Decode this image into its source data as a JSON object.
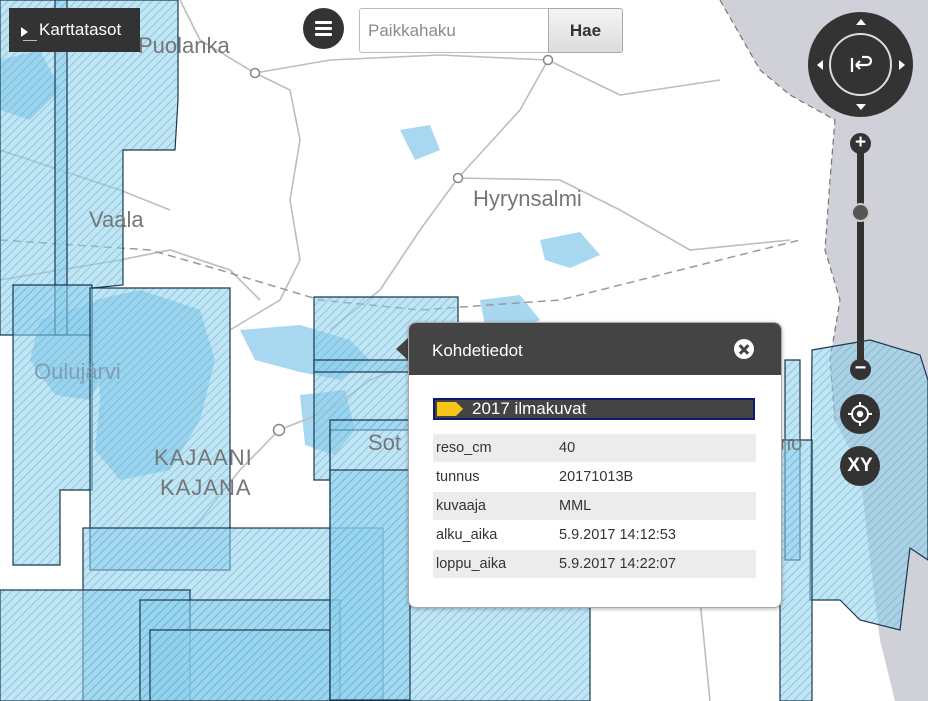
{
  "map": {
    "place_labels": {
      "puolanka": "Puolanka",
      "vaala": "Vaala",
      "hyrynsalmi": "Hyrynsalmi",
      "oulujarvi": "Oulujärvi",
      "kajaani": "KAJAANI",
      "kajana": "KAJANA",
      "sotkamo_partial": "Sot",
      "partial_right": "no"
    },
    "colors": {
      "coverage_fill": "#8fd0ea",
      "coverage_stroke": "#1a3850",
      "water": "#a8d8f0",
      "roads": "#bdbdbd",
      "border_area": "#d0d0d8"
    }
  },
  "layers_button": {
    "label": "Karttatasot",
    "icon": "caret-right-icon"
  },
  "menu_button": {
    "icon": "hamburger-menu-icon"
  },
  "search": {
    "placeholder": "Paikkahaku",
    "value": "",
    "button_label": "Hae"
  },
  "pan_control": {
    "center_icon": "return-arrow-icon",
    "arrows": [
      "up",
      "down",
      "left",
      "right"
    ]
  },
  "zoom": {
    "plus": "+",
    "minus": "−",
    "level_fraction": 0.7
  },
  "locate_button": {
    "icon": "crosshair-icon"
  },
  "xy_button": {
    "label": "XY"
  },
  "popup": {
    "title": "Kohdetiedot",
    "close_icon": "close-icon",
    "layer_name": "2017 ilmakuvat",
    "layer_color": "#f5c518",
    "rows": [
      {
        "key": "reso_cm",
        "value": "40"
      },
      {
        "key": "tunnus",
        "value": "20171013B"
      },
      {
        "key": "kuvaaja",
        "value": "MML"
      },
      {
        "key": "alku_aika",
        "value": "5.9.2017 14:12:53"
      },
      {
        "key": "loppu_aika",
        "value": "5.9.2017 14:22:07"
      }
    ]
  }
}
